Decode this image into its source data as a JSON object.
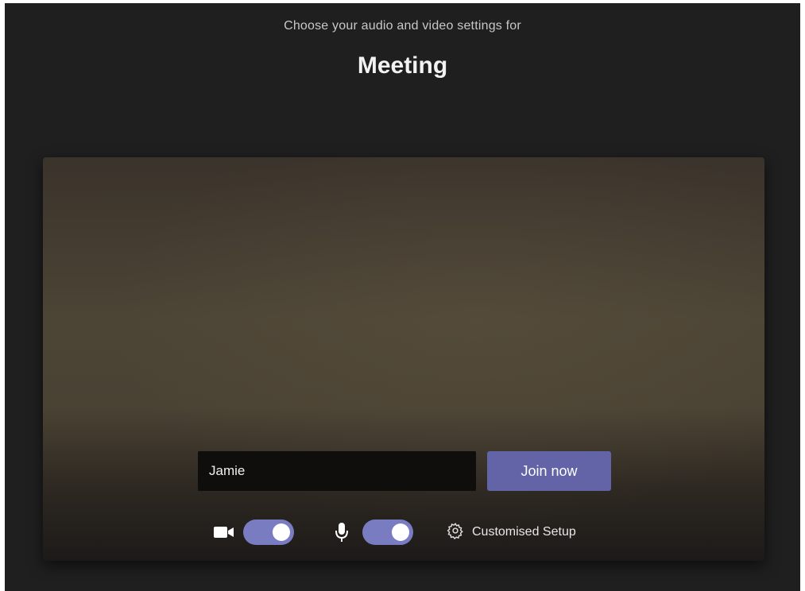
{
  "header": {
    "subtitle": "Choose your audio and video settings for",
    "title": "Meeting"
  },
  "join": {
    "name_value": "Jamie",
    "join_label": "Join now"
  },
  "controls": {
    "camera": {
      "icon": "camera-icon",
      "on": true
    },
    "microphone": {
      "icon": "microphone-icon",
      "on": true
    },
    "setup": {
      "icon": "gear-icon",
      "label": "Customised Setup"
    }
  },
  "colors": {
    "background": "#1f1f1f",
    "accent": "#6264a7",
    "toggle_on": "#7a7cc2"
  }
}
